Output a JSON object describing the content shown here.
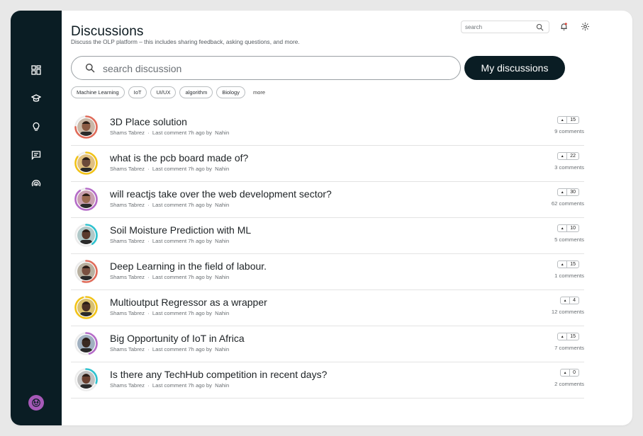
{
  "header": {
    "title": "Discussions",
    "subtitle": "Discuss the OLP platform  – this includes sharing feedback, asking questions, and more.",
    "top_search_placeholder": "search"
  },
  "search": {
    "placeholder": "search discussion",
    "my_discussions_label": "My discussions"
  },
  "tags": [
    "Machine Learning",
    "IoT",
    "UI/UX",
    "algorithm",
    "Biology"
  ],
  "tags_more_label": "more",
  "colors": {
    "sidebar": "#0a1d24",
    "accent_dark": "#0a1d24",
    "ring_colors": [
      "#e06c5a",
      "#f2c318",
      "#b56cc8",
      "#2fc2cf"
    ]
  },
  "discussions": [
    {
      "title": "3D Place solution",
      "author": "Shams Tabrez",
      "last_comment": "Last comment 7h ago by",
      "by": "Nahin",
      "votes": "15",
      "comments": "9 comments",
      "ring": "#e06c5a",
      "ring_pct": 0.75
    },
    {
      "title": "what is the pcb board made of?",
      "author": "Shams Tabrez",
      "last_comment": "Last comment 7h ago by",
      "by": "Nahin",
      "votes": "22",
      "comments": "3 comments",
      "ring": "#f2c318",
      "ring_pct": 0.85
    },
    {
      "title": "will reactjs take over the web development sector?",
      "author": "Shams Tabrez",
      "last_comment": "Last comment 7h ago by",
      "by": "Nahin",
      "votes": "30",
      "comments": "62 comments",
      "ring": "#b56cc8",
      "ring_pct": 0.9
    },
    {
      "title": "Soil Moisture Prediction with ML",
      "author": "Shams Tabrez",
      "last_comment": "Last comment 7h ago by",
      "by": "Nahin",
      "votes": "10",
      "comments": "5 comments",
      "ring": "#2fc2cf",
      "ring_pct": 0.4
    },
    {
      "title": "Deep Learning in the field of labour.",
      "author": "Shams Tabrez",
      "last_comment": "Last comment 7h ago by",
      "by": "Nahin",
      "votes": "15",
      "comments": "1 comments",
      "ring": "#e06c5a",
      "ring_pct": 0.55
    },
    {
      "title": "Multioutput Regressor as a wrapper",
      "author": "Shams Tabrez",
      "last_comment": "Last comment 7h ago by",
      "by": "Nahin",
      "votes": "4",
      "comments": "12 comments",
      "ring": "#f2c318",
      "ring_pct": 0.95
    },
    {
      "title": "Big Opportunity of IoT in Africa",
      "author": "Shams Tabrez",
      "last_comment": "Last comment 7h ago by",
      "by": "Nahin",
      "votes": "15",
      "comments": "7 comments",
      "ring": "#b56cc8",
      "ring_pct": 0.45
    },
    {
      "title": "Is there any TechHub competition in recent days?",
      "author": "Shams Tabrez",
      "last_comment": "Last comment 7h ago by",
      "by": "Nahin",
      "votes": "0",
      "comments": "2 comments",
      "ring": "#2fc2cf",
      "ring_pct": 0.3
    }
  ],
  "sidebar": {
    "icons": [
      "dashboard-icon",
      "graduation-cap-icon",
      "lightbulb-icon",
      "chat-icon",
      "broadcast-icon"
    ],
    "avatar_icon": "user-avatar-icon"
  }
}
